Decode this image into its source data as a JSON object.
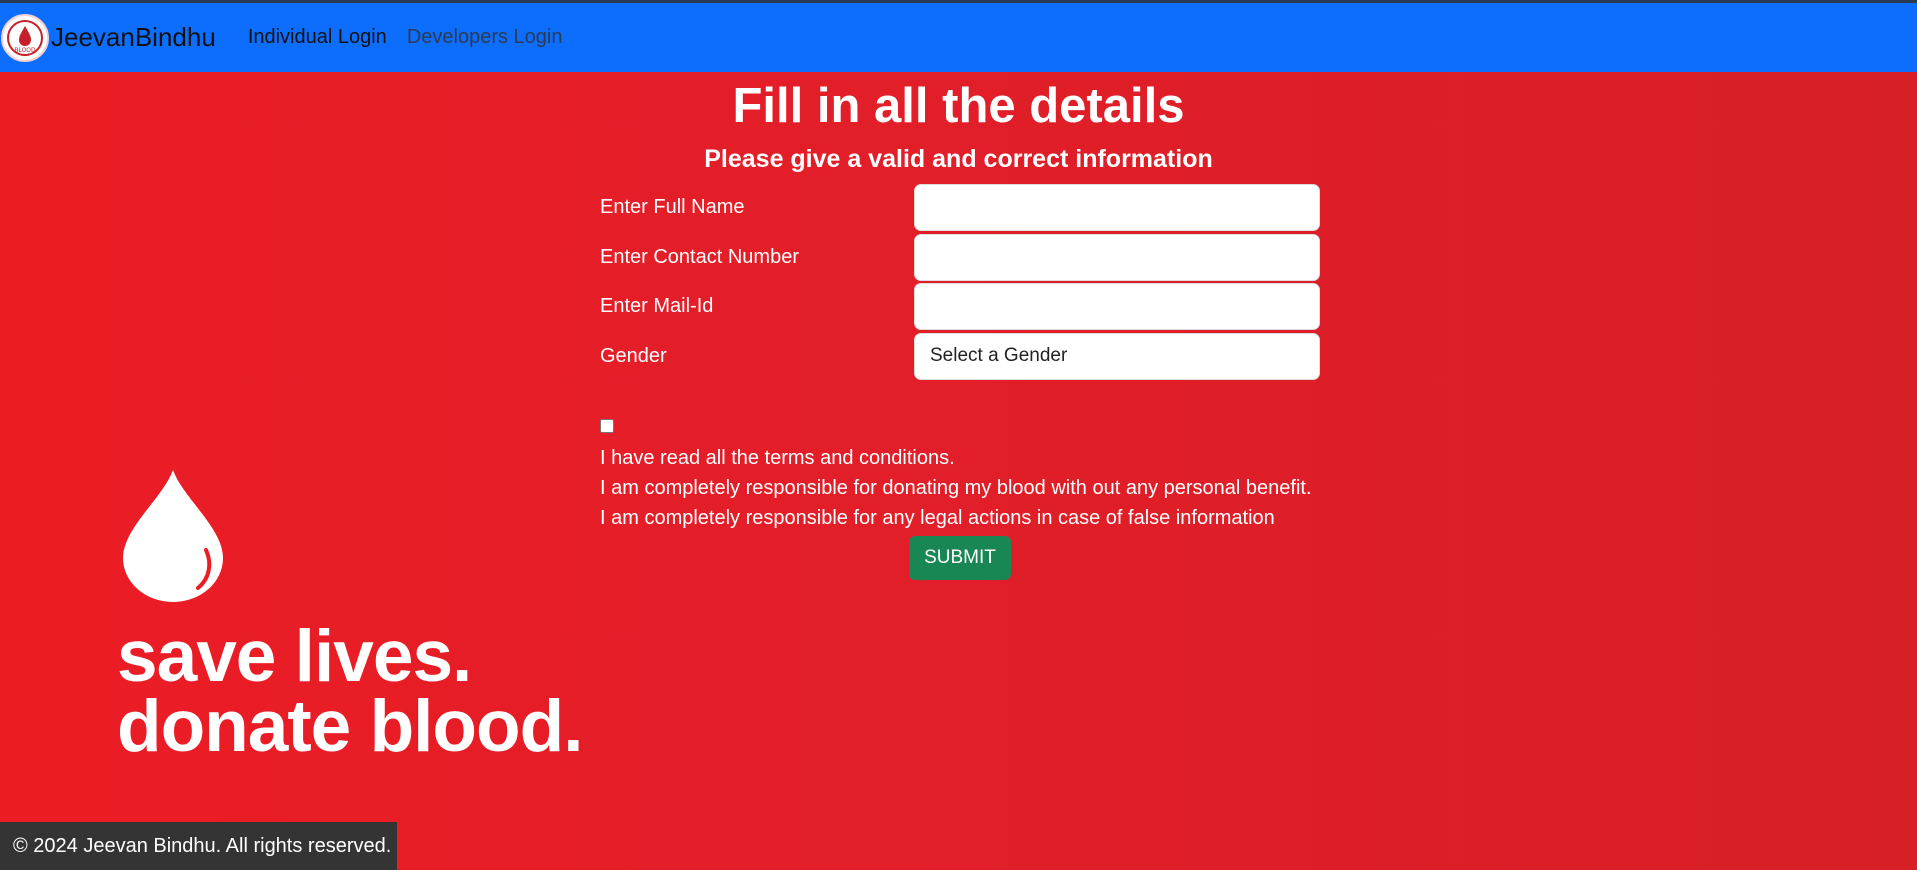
{
  "nav": {
    "brand": "JeevanBindhu",
    "logo_text": "BLOOD",
    "links": [
      "Individual Login",
      "Developers Login"
    ]
  },
  "form": {
    "title": "Fill in all the details",
    "subtitle": "Please give a valid and correct information",
    "fields": [
      {
        "label": "Enter Full Name",
        "value": ""
      },
      {
        "label": "Enter Contact Number",
        "value": ""
      },
      {
        "label": "Enter Mail-Id",
        "value": ""
      },
      {
        "label": "Gender",
        "value": "Select a Gender"
      }
    ],
    "terms": [
      "I have read all the terms and conditions.",
      "I am completely responsible for donating my blood with out any personal benefit.",
      "I am completely responsible for any legal actions in case of false information"
    ],
    "checkbox_checked": false,
    "submit": "SUBMIT"
  },
  "banner": {
    "line1": "save lives.",
    "line2": "donate blood."
  },
  "footer": {
    "text": "© 2024 Jeevan Bindhu. All rights reserved."
  },
  "colors": {
    "navbar": "#0d6efd",
    "background": "#e21e29",
    "submit": "#198754",
    "footer": "#343434"
  }
}
